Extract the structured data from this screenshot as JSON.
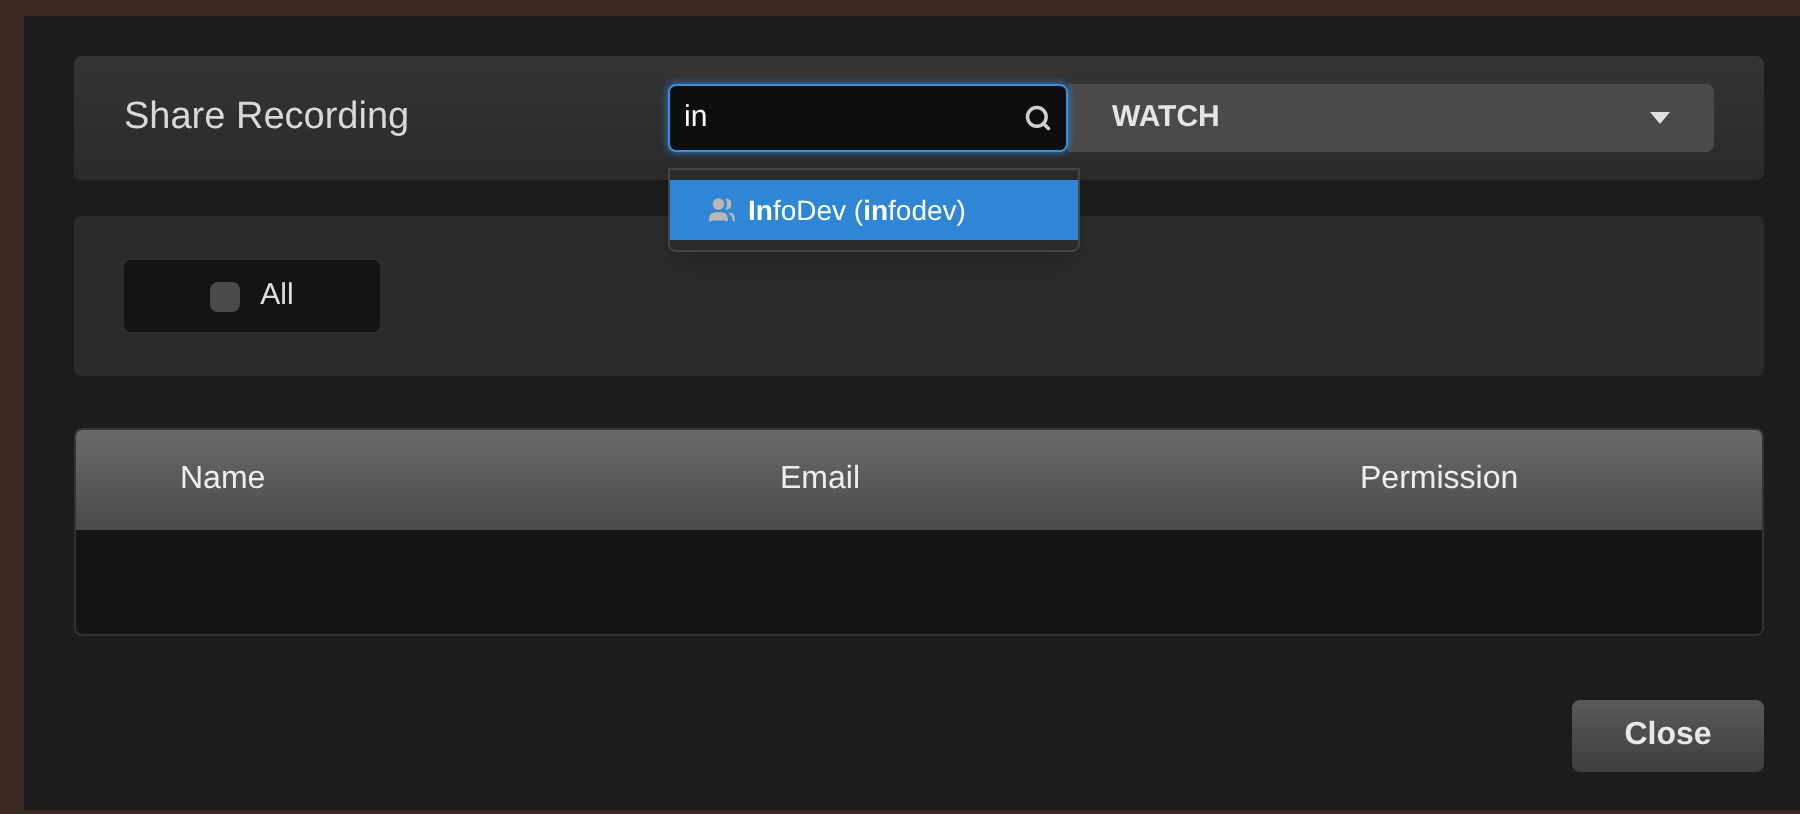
{
  "dialog": {
    "title": "Share Recording"
  },
  "search": {
    "value": "in"
  },
  "permission_select": {
    "value": "WATCH"
  },
  "suggestions": [
    {
      "label": "**In**foDev (**in**fodev)",
      "selected": true
    }
  ],
  "all_toggle": {
    "label": "All",
    "checked": false
  },
  "table": {
    "columns": [
      "Name",
      "Email",
      "Permission"
    ]
  },
  "buttons": [
    "Close"
  ]
}
